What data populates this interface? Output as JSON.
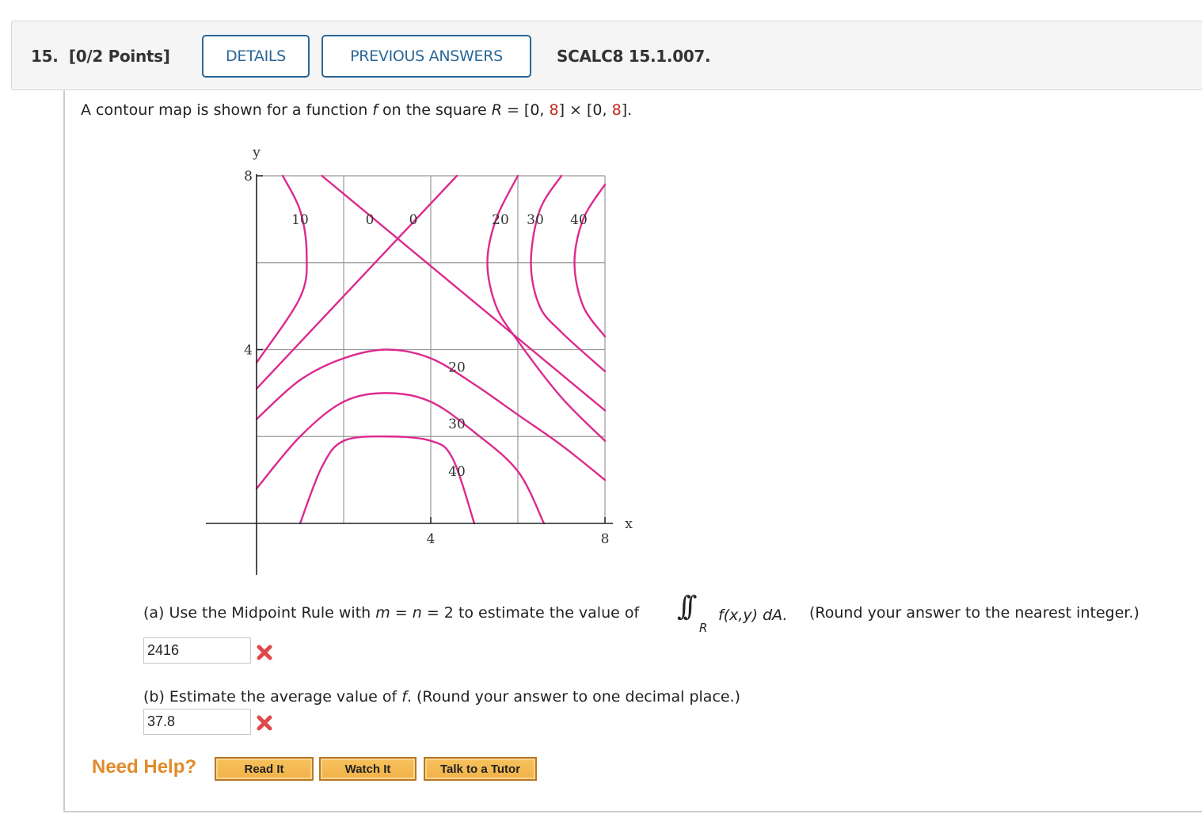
{
  "header": {
    "question_number": "15.",
    "points": "[0/2 Points]",
    "details_label": "DETAILS",
    "previous_answers_label": "PREVIOUS ANSWERS",
    "question_code": "SCALC8 15.1.007."
  },
  "intro": {
    "text_before_f": "A contour map is shown for a function ",
    "f": "f",
    "text_on_square": " on the square ",
    "R": "R",
    "eq": " = [0, ",
    "eight1": "8",
    "times": "] × [0, ",
    "eight2": "8",
    "close": "]."
  },
  "chart_data": {
    "type": "contour",
    "xlabel": "x",
    "ylabel": "y",
    "xlim": [
      0,
      8
    ],
    "ylim": [
      0,
      8
    ],
    "grid": true,
    "grid_step": 2,
    "x_ticks": [
      {
        "value": 4,
        "label": "4"
      },
      {
        "value": 8,
        "label": "8"
      }
    ],
    "y_ticks": [
      {
        "value": 4,
        "label": "4"
      },
      {
        "value": 8,
        "label": "8"
      }
    ],
    "line_color": "#dc2a8e",
    "contour_labels": [
      {
        "label": "10",
        "x": 1.0,
        "y": 7.0
      },
      {
        "label": "0",
        "x": 2.6,
        "y": 7.0
      },
      {
        "label": "0",
        "x": 3.6,
        "y": 7.0
      },
      {
        "label": "20",
        "x": 5.6,
        "y": 7.0
      },
      {
        "label": "30",
        "x": 6.4,
        "y": 7.0
      },
      {
        "label": "40",
        "x": 7.4,
        "y": 7.0
      },
      {
        "label": "20",
        "x": 4.6,
        "y": 3.6
      },
      {
        "label": "30",
        "x": 4.6,
        "y": 2.3
      },
      {
        "label": "40",
        "x": 4.6,
        "y": 1.2
      }
    ],
    "contours": [
      {
        "level": 10,
        "points": [
          [
            0.6,
            8
          ],
          [
            1.0,
            7.2
          ],
          [
            1.15,
            6.2
          ],
          [
            1.0,
            5.2
          ],
          [
            0,
            3.7
          ]
        ]
      },
      {
        "level": 10,
        "points": [
          [
            0,
            2.4
          ],
          [
            1.0,
            3.3
          ],
          [
            2.0,
            3.8
          ],
          [
            3.0,
            4.0
          ],
          [
            4.0,
            3.8
          ],
          [
            5.0,
            3.2
          ],
          [
            6.0,
            2.5
          ],
          [
            7.0,
            1.8
          ],
          [
            8.0,
            1.0
          ]
        ]
      },
      {
        "level": 0,
        "points": [
          [
            1.5,
            8
          ],
          [
            8,
            2.6
          ]
        ]
      },
      {
        "level": 0,
        "points": [
          [
            0,
            3.1
          ],
          [
            4.6,
            8
          ]
        ]
      },
      {
        "level": 20,
        "points": [
          [
            0,
            0.8
          ],
          [
            1.0,
            2.0
          ],
          [
            2.0,
            2.8
          ],
          [
            3.0,
            3.0
          ],
          [
            4.0,
            2.8
          ],
          [
            5.0,
            2.1
          ],
          [
            6.0,
            1.2
          ],
          [
            6.6,
            0
          ]
        ]
      },
      {
        "level": 30,
        "points": [
          [
            1.0,
            0
          ],
          [
            1.5,
            1.3
          ],
          [
            2.0,
            1.9
          ],
          [
            3.0,
            2.0
          ],
          [
            4.0,
            1.9
          ],
          [
            4.5,
            1.5
          ],
          [
            5.0,
            0
          ]
        ]
      },
      {
        "level": 20,
        "points": [
          [
            6.0,
            8
          ],
          [
            5.5,
            7.0
          ],
          [
            5.3,
            6.0
          ],
          [
            5.5,
            5.0
          ],
          [
            6.0,
            4.2
          ],
          [
            7.0,
            2.9
          ],
          [
            8.0,
            1.9
          ]
        ]
      },
      {
        "level": 30,
        "points": [
          [
            7.0,
            8
          ],
          [
            6.5,
            7.2
          ],
          [
            6.3,
            6.0
          ],
          [
            6.5,
            5.0
          ],
          [
            7.0,
            4.4
          ],
          [
            8.0,
            3.5
          ]
        ]
      },
      {
        "level": 40,
        "points": [
          [
            8.0,
            7.8
          ],
          [
            7.5,
            7.0
          ],
          [
            7.3,
            6.0
          ],
          [
            7.5,
            5.0
          ],
          [
            8.0,
            4.3
          ]
        ]
      }
    ]
  },
  "part_a": {
    "prefix": "(a) Use the Midpoint Rule with ",
    "m": "m",
    "eq1": " = ",
    "n": "n",
    "eq2": " = 2 to estimate the value of",
    "integral_symbol": "∫∫",
    "region": "R",
    "integrand": "f(x,y) dA.",
    "note": "(Round your answer to the nearest integer.)",
    "answer_value": "2416",
    "status": "incorrect"
  },
  "part_b": {
    "prefix": "(b) Estimate the average value of ",
    "f": "f",
    "suffix": ". (Round your answer to one decimal place.)",
    "answer_value": "37.8",
    "status": "incorrect"
  },
  "help": {
    "label": "Need Help?",
    "buttons": [
      "Read It",
      "Watch It",
      "Talk to a Tutor"
    ]
  }
}
